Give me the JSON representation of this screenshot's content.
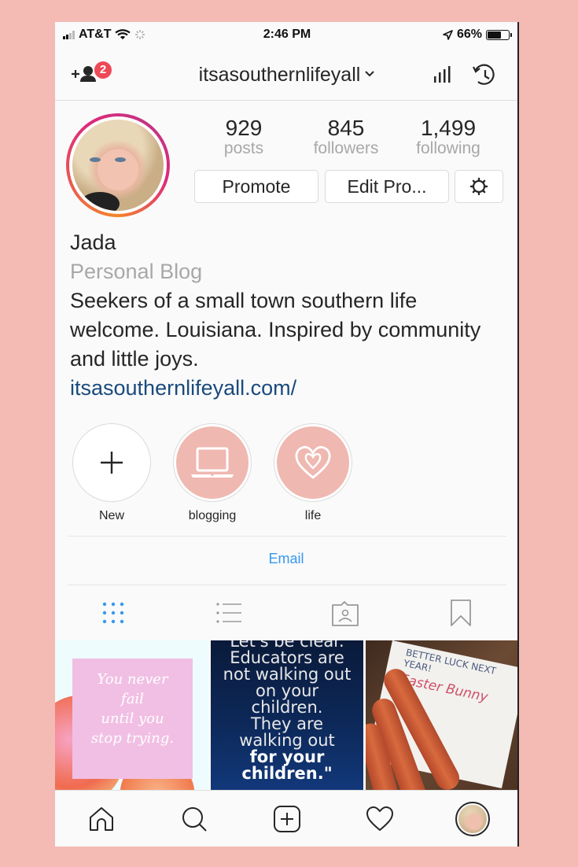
{
  "status_bar": {
    "carrier": "AT&T",
    "time": "2:46 PM",
    "battery": "66%",
    "battery_level": 0.66
  },
  "header": {
    "username": "itsasouthernlifeyall",
    "notification_count": "2",
    "icons": [
      "add-user-icon",
      "chevron-down-icon",
      "insights-icon",
      "archive-icon"
    ]
  },
  "profile": {
    "stats": [
      {
        "value": "929",
        "label": "posts"
      },
      {
        "value": "845",
        "label": "followers"
      },
      {
        "value": "1,499",
        "label": "following"
      }
    ],
    "buttons": {
      "promote": "Promote",
      "edit_profile": "Edit Pro..."
    },
    "name": "Jada",
    "category": "Personal Blog",
    "bio": "Seekers of a small town southern life welcome. Louisiana. Inspired by community and little joys.",
    "website": "itsasouthernlifeyall.com/"
  },
  "highlights": [
    {
      "label": "New",
      "icon": "plus-icon"
    },
    {
      "label": "blogging",
      "icon": "laptop-icon"
    },
    {
      "label": "life",
      "icon": "heart-icon"
    }
  ],
  "contact": {
    "email_label": "Email"
  },
  "tabs": [
    {
      "name": "grid",
      "icon": "grid-icon",
      "active": true
    },
    {
      "name": "list",
      "icon": "list-icon",
      "active": false
    },
    {
      "name": "tagged",
      "icon": "tagged-icon",
      "active": false
    },
    {
      "name": "saved",
      "icon": "bookmark-icon",
      "active": false
    }
  ],
  "posts": [
    {
      "type": "quote-card",
      "lines": [
        "You never",
        "fail",
        "until you",
        "stop trying."
      ]
    },
    {
      "type": "text-quote",
      "lines": [
        "Let's be clear.",
        "Educators are",
        "not walking out",
        "on your",
        "children.",
        "They are",
        "walking out"
      ],
      "bold_lines": [
        "for your",
        "children.\""
      ]
    },
    {
      "type": "photo",
      "note_lines": [
        "BETTER LUCK NEXT",
        "YEAR!"
      ],
      "signature": "Easter Bunny"
    }
  ],
  "bottom_nav": [
    {
      "name": "home",
      "icon": "home-icon"
    },
    {
      "name": "search",
      "icon": "search-icon"
    },
    {
      "name": "new-post",
      "icon": "add-post-icon"
    },
    {
      "name": "activity",
      "icon": "heart-outline-icon"
    },
    {
      "name": "profile",
      "icon": "profile-avatar"
    }
  ],
  "colors": {
    "background": "#f3bbb4",
    "accent_blue": "#3897f0",
    "link_blue": "#1a4a7d",
    "badge_red": "#ed4956",
    "highlight_pink": "#efb8b1"
  }
}
